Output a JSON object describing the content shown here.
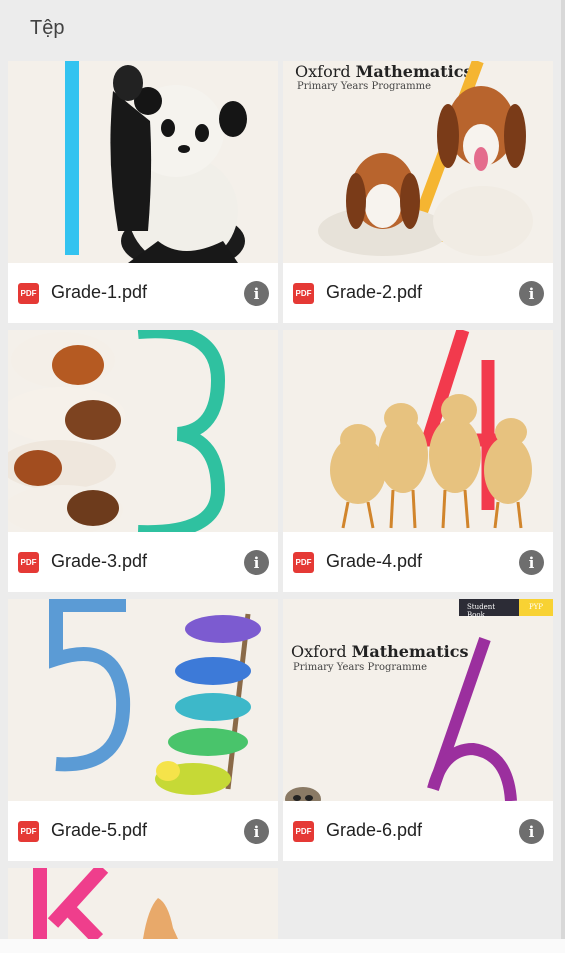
{
  "header": {
    "title": "Tệp"
  },
  "files": [
    {
      "name": "Grade-1.pdf",
      "type_label": "PDF",
      "cover_digit": "1",
      "digit_color": "#33c3f0"
    },
    {
      "name": "Grade-2.pdf",
      "type_label": "PDF",
      "cover_digit": "2",
      "digit_color": "#f5b531",
      "cover_title_a": "Oxford ",
      "cover_title_b": "Mathematics",
      "cover_subtitle": "Primary Years Programme"
    },
    {
      "name": "Grade-3.pdf",
      "type_label": "PDF",
      "cover_digit": "3",
      "digit_color": "#2fc1a0"
    },
    {
      "name": "Grade-4.pdf",
      "type_label": "PDF",
      "cover_digit": "4",
      "digit_color": "#f23a4d"
    },
    {
      "name": "Grade-5.pdf",
      "type_label": "PDF",
      "cover_digit": "5",
      "digit_color": "#5b9bd5"
    },
    {
      "name": "Grade-6.pdf",
      "type_label": "PDF",
      "cover_digit": "6",
      "digit_color": "#9b2f9e",
      "cover_title_a": "Oxford ",
      "cover_title_b": "Mathematics",
      "cover_subtitle": "Primary Years Programme",
      "badge_left": "Student Book",
      "badge_right": "PYP"
    },
    {
      "name": "",
      "type_label": "",
      "cover_digit": "K",
      "digit_color": "#ef3e8c"
    }
  ],
  "icons": {
    "file_type": "pdf-icon",
    "info": "info-icon"
  },
  "colors": {
    "pdf_red": "#e53935",
    "info_grey": "#6e6e6e",
    "background": "#ececec"
  }
}
